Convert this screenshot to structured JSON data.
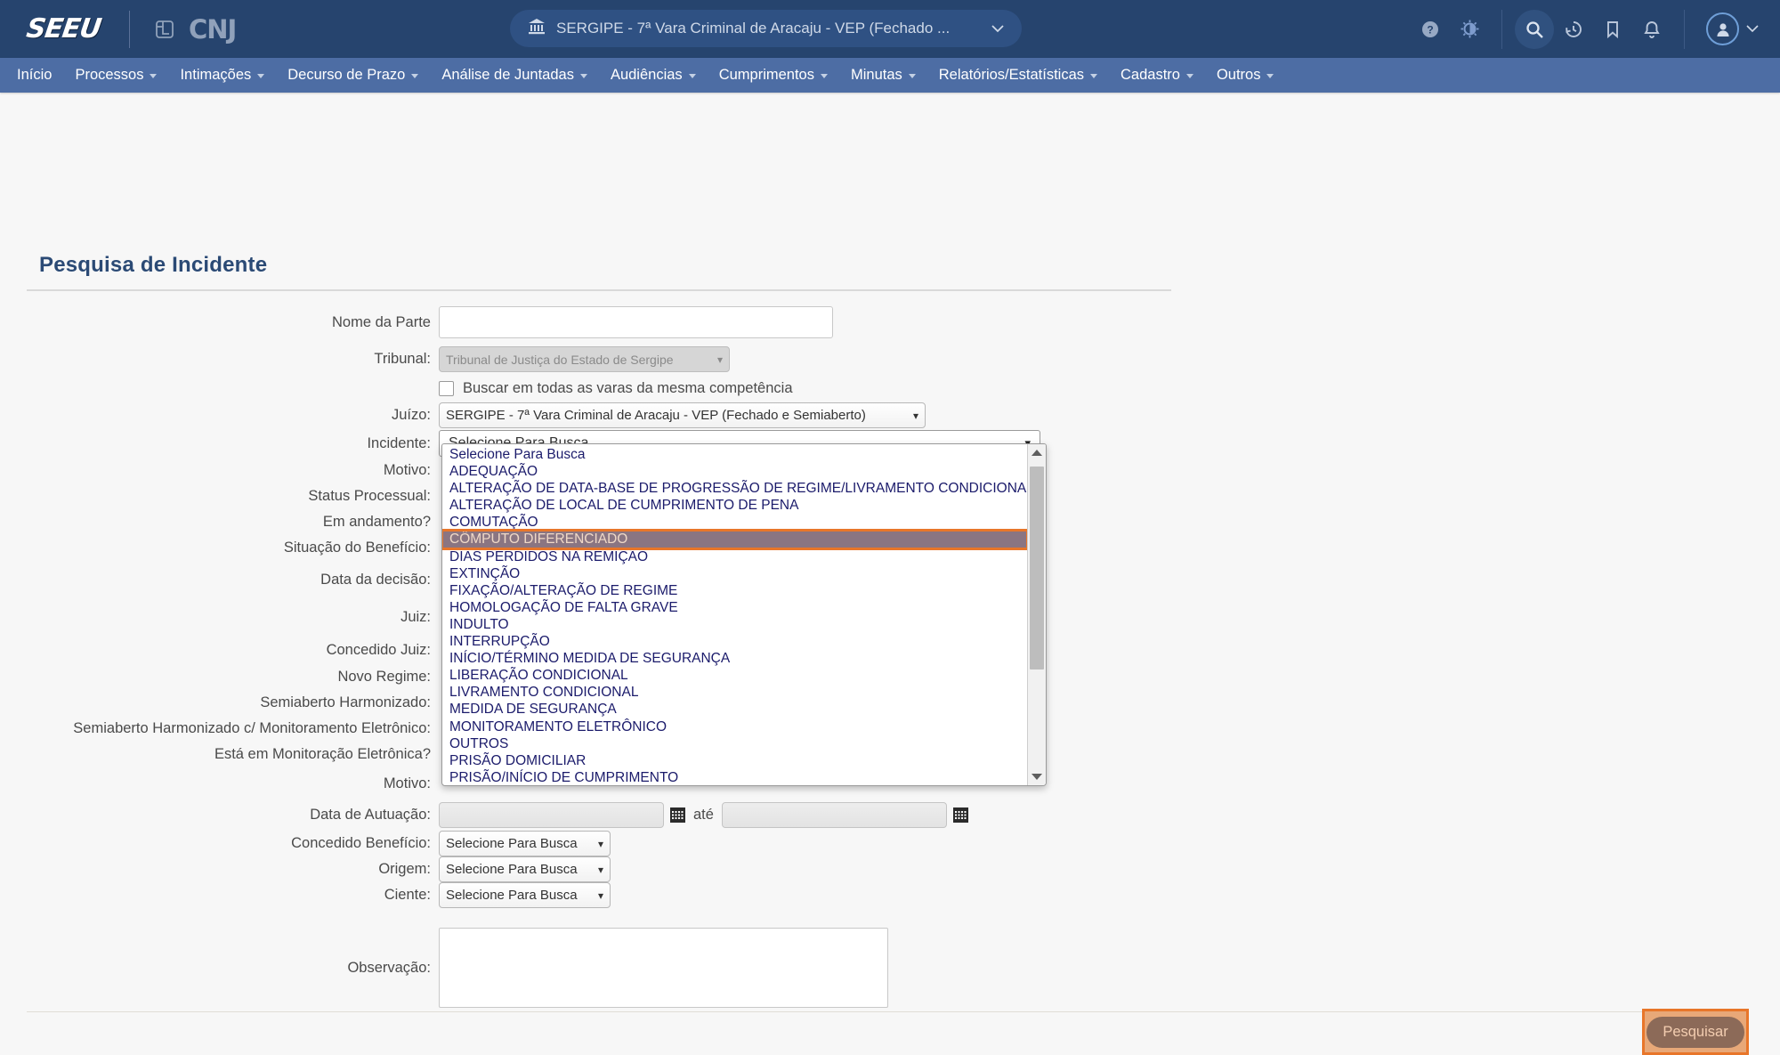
{
  "header": {
    "logo_text": "SEEU",
    "cnj_text": "CNJ",
    "cnj_icon": "cnj-logo-icon",
    "court_selector": {
      "icon": "bank-icon",
      "label": "SERGIPE - 7ª Vara Criminal de Aracaju - VEP (Fechado ...",
      "caret": "⌄"
    },
    "icons": [
      {
        "name": "help-icon",
        "glyph": "?"
      },
      {
        "name": "contrast-icon",
        "glyph": "◑"
      },
      {
        "name": "search-icon",
        "glyph": "search"
      },
      {
        "name": "history-icon",
        "glyph": "history"
      },
      {
        "name": "bookmark-icon",
        "glyph": "bookmark"
      },
      {
        "name": "bell-icon",
        "glyph": "bell"
      }
    ],
    "avatar": {
      "name": "user-avatar",
      "caret": "⌄"
    }
  },
  "menu": {
    "items": [
      {
        "label": "Início",
        "has_caret": false
      },
      {
        "label": "Processos",
        "has_caret": true
      },
      {
        "label": "Intimações",
        "has_caret": true
      },
      {
        "label": "Decurso de Prazo",
        "has_caret": true
      },
      {
        "label": "Análise de Juntadas",
        "has_caret": true
      },
      {
        "label": "Audiências",
        "has_caret": true
      },
      {
        "label": "Cumprimentos",
        "has_caret": true
      },
      {
        "label": "Minutas",
        "has_caret": true
      },
      {
        "label": "Relatórios/Estatísticas",
        "has_caret": true
      },
      {
        "label": "Cadastro",
        "has_caret": true
      },
      {
        "label": "Outros",
        "has_caret": true
      }
    ]
  },
  "page": {
    "title": "Pesquisa de Incidente"
  },
  "form": {
    "nome_parte": {
      "label": "Nome da Parte",
      "value": "",
      "placeholder": ""
    },
    "tribunal": {
      "label": "Tribunal:",
      "value": "Tribunal de Justiça do Estado de Sergipe",
      "disabled": true
    },
    "buscar_varas": {
      "label": "Buscar em todas as varas da mesma competência",
      "checked": false
    },
    "juizo": {
      "label": "Juízo:",
      "value": "SERGIPE - 7ª Vara Criminal de Aracaju - VEP (Fechado e Semiaberto)"
    },
    "incidente": {
      "label": "Incidente:",
      "value": "Selecione Para Busca"
    },
    "motivo": {
      "label": "Motivo:"
    },
    "status_processual": {
      "label": "Status Processual:"
    },
    "em_andamento": {
      "label": "Em andamento?"
    },
    "situacao_beneficio": {
      "label": "Situação do Benefício:"
    },
    "data_decisao": {
      "label": "Data da decisão:"
    },
    "juiz": {
      "label": "Juiz:"
    },
    "concedido_juiz": {
      "label": "Concedido Juiz:"
    },
    "novo_regime": {
      "label": "Novo Regime:"
    },
    "semiaberto_harmonizado": {
      "label": "Semiaberto Harmonizado:"
    },
    "semiaberto_harmonizado_monit": {
      "label": "Semiaberto Harmonizado c/ Monitoramento Eletrônico:"
    },
    "monitoracao_eletronica": {
      "label": "Está em Monitoração Eletrônica?"
    },
    "motivo2": {
      "label": "Motivo:"
    },
    "data_autuacao": {
      "label": "Data de Autuação:",
      "from_value": "",
      "ate_label": "até",
      "to_value": "",
      "calendar_icon": "calendar-icon"
    },
    "concedido_beneficio": {
      "label": "Concedido Benefício:",
      "value": "Selecione Para Busca"
    },
    "origem": {
      "label": "Origem:",
      "value": "Selecione Para Busca"
    },
    "ciente": {
      "label": "Ciente:",
      "value": "Selecione Para Busca"
    },
    "observacao": {
      "label": "Observação:",
      "value": ""
    }
  },
  "incidente_dropdown": {
    "open": true,
    "selected_index": 5,
    "options": [
      "Selecione Para Busca",
      "ADEQUAÇÃO",
      "ALTERAÇÃO DE DATA-BASE DE PROGRESSÃO DE REGIME/LIVRAMENTO CONDICIONAL",
      "ALTERAÇÃO DE LOCAL DE CUMPRIMENTO DE PENA",
      "COMUTAÇÃO",
      "CÔMPUTO DIFERENCIADO",
      "DIAS PERDIDOS NA REMIÇÃO",
      "EXTINÇÃO",
      "FIXAÇÃO/ALTERAÇÃO DE REGIME",
      "HOMOLOGAÇÃO DE FALTA GRAVE",
      "INDULTO",
      "INTERRUPÇÃO",
      "INÍCIO/TÉRMINO MEDIDA DE SEGURANÇA",
      "LIBERAÇÃO CONDICIONAL",
      "LIVRAMENTO CONDICIONAL",
      "MEDIDA DE SEGURANÇA",
      "MONITORAMENTO ELETRÔNICO",
      "OUTROS",
      "PRISÃO DOMICILIAR",
      "PRISÃO/INÍCIO DE CUMPRIMENTO"
    ]
  },
  "footer": {
    "search_button": "Pesquisar"
  },
  "colors": {
    "topbar": "#26446e",
    "menubar": "#4d6da4",
    "title": "#2b4a75",
    "highlight_border": "#e8762a",
    "selected_row_bg": "#8a7582",
    "button_bg": "#8c6a58"
  }
}
